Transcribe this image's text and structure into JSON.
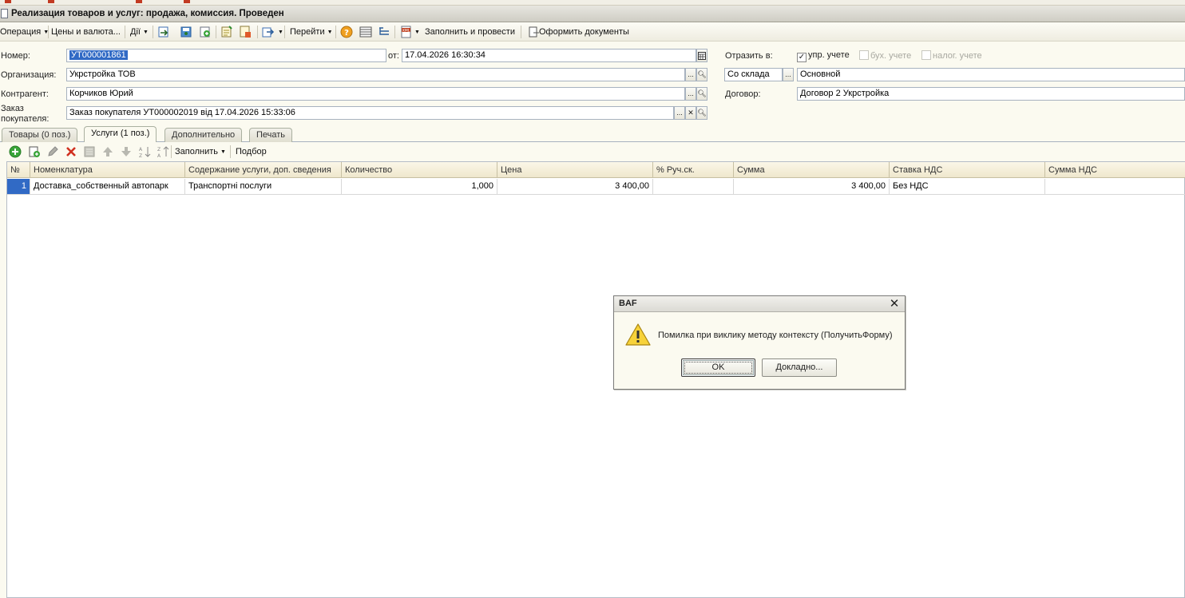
{
  "window": {
    "title": "Реализация товаров и услуг: продажа, комиссия. Проведен"
  },
  "toolbar": {
    "operation": "Операция",
    "prices": "Цены и валюта...",
    "actions": "Дії",
    "goto": "Перейти",
    "fill_post": "Заполнить и провести",
    "docs": "Оформить документы"
  },
  "form": {
    "number_label": "Номер:",
    "number_value": "УТ000001861",
    "date_label": "от:",
    "date_value": "17.04.2026 16:30:34",
    "org_label": "Организация:",
    "org_value": "Укрстройка ТОВ",
    "contractor_label": "Контрагент:",
    "contractor_value": "Корчиков Юрий",
    "order_label_1": "Заказ",
    "order_label_2": "покупателя:",
    "order_value": "Заказ покупателя УТ000002019 від 17.04.2026 15:33:06",
    "reflect_label": "Отразить в:",
    "cb_upr": "упр. учете",
    "cb_buh": "бух. учете",
    "cb_nalog": "налог. учете",
    "warehouse_mode": "Со склада",
    "warehouse_value": "Основной",
    "contract_label": "Договор:",
    "contract_value": "Договор 2 Укрстройка"
  },
  "tabs": [
    {
      "label": "Товары (0 поз.)"
    },
    {
      "label": "Услуги (1 поз.)"
    },
    {
      "label": "Дополнительно"
    },
    {
      "label": "Печать"
    }
  ],
  "grid_toolbar": {
    "fill": "Заполнить",
    "select": "Подбор"
  },
  "grid": {
    "columns": [
      "№",
      "Номенклатура",
      "Содержание услуги, доп. сведения",
      "Количество",
      "Цена",
      "% Руч.ск.",
      "Сумма",
      "Ставка НДС",
      "Сумма НДС"
    ],
    "rows": [
      {
        "n": "1",
        "nom": "Доставка_собственный автопарк",
        "content": "Транспортні послуги",
        "qty": "1,000",
        "price": "3 400,00",
        "disc": "",
        "sum": "3 400,00",
        "vat_rate": "Без НДС",
        "vat_sum": ""
      }
    ]
  },
  "dialog": {
    "title": "BAF",
    "message": "Помилка при виклику методу контексту (ПолучитьФорму)",
    "ok": "OK",
    "details": "Докладно..."
  },
  "colors": {
    "selection": "#316ac5",
    "background": "#fbfaf0",
    "grid_header": "#efe7cd"
  }
}
